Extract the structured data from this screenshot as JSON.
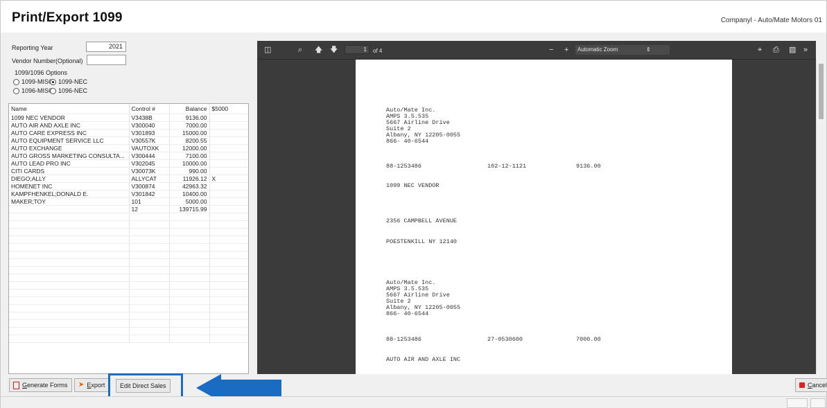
{
  "header": {
    "title": "Print/Export 1099",
    "company": "Companyl - Auto/Mate Motors 01"
  },
  "form": {
    "reporting_year_label": "Reporting Year",
    "reporting_year": "2021",
    "vendor_number_label": "Vendor Number(Optional)",
    "vendor_number": "",
    "options_label": "1099/1096 Options",
    "options": [
      {
        "label": "1099-MISC",
        "selected": false
      },
      {
        "label": "1099-NEC",
        "selected": true
      },
      {
        "label": "1096-MISC",
        "selected": false
      },
      {
        "label": "1096-NEC",
        "selected": false
      }
    ]
  },
  "vendor_table": {
    "columns": [
      "Name",
      "Control #",
      "Balance",
      "$5000"
    ],
    "rows": [
      [
        "1099 NEC VENDOR",
        "V3438B",
        "9136.00",
        ""
      ],
      [
        "AUTO AIR AND AXLE INC",
        "V300040",
        "7000.00",
        ""
      ],
      [
        "AUTO CARE EXPRESS INC",
        "V301893",
        "15000.00",
        ""
      ],
      [
        "AUTO EQUIPMENT SERVICE LLC",
        "V30557K",
        "8200.55",
        ""
      ],
      [
        "AUTO EXCHANGE",
        "VAUTOXK",
        "12000.00",
        ""
      ],
      [
        "AUTO GROSS MARKETING CONSULTA...",
        "V300444",
        "7100.00",
        ""
      ],
      [
        "AUTO LEAD PRO INC",
        "V302045",
        "10000.00",
        ""
      ],
      [
        "CITI CARDS",
        "V30073K",
        "990.00",
        ""
      ],
      [
        "DIEGO;ALLY",
        "ALLYCAT",
        "11926.12",
        "X"
      ],
      [
        "HOMENET INC",
        "V300874",
        "42963.32",
        ""
      ],
      [
        "KAMPFHENKEL;DONALD E.",
        "V301842",
        "10400.00",
        ""
      ],
      [
        "MAKER;TOY",
        "101",
        "5000.00",
        ""
      ],
      [
        "",
        "12",
        "139715.99",
        ""
      ]
    ],
    "empty_rows": 17
  },
  "viewer": {
    "page_current": "1",
    "page_of": "of 4",
    "zoom": "Automatic Zoom",
    "document_lines": [
      "Auto/Mate Inc.",
      "AMPS 3.5.535",
      "5667 Airline Drive",
      "Suite 2",
      "Albany, NY 12205-0055",
      "866- 40-6544",
      "88-1253486",
      "102-12-1121",
      "9136.00",
      "1099 NEC VENDOR",
      "2356 CAMPBELL AVENUE",
      "POESTENKILL NY 12140",
      "Auto/Mate Inc.",
      "AMPS 3.5.535",
      "5667 Airline Drive",
      "Suite 2",
      "Albany, NY 12205-0055",
      "866- 40-6544",
      "88-1253486",
      "27-0530600",
      "7000.00",
      "AUTO AIR AND AXLE INC"
    ]
  },
  "buttons": {
    "generate_forms_underline": "G",
    "generate_forms_rest": "enerate Forms",
    "export_underline": "E",
    "export_rest": "xport",
    "edit_direct_sales": "Edit Direct Sales",
    "cancel_underline": "C",
    "cancel_rest": "ancel"
  },
  "colors": {
    "highlight": "#1a6bc2",
    "viewer_bg": "#3b3b3b"
  }
}
